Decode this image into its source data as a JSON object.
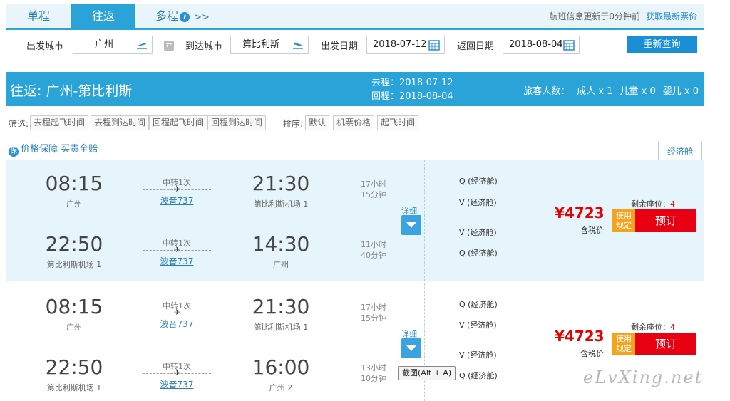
{
  "tabs": [
    {
      "label": "单程"
    },
    {
      "label": "往返"
    },
    {
      "label": "多程"
    }
  ],
  "tab_more": ">>",
  "update_text": "航班信息更新于0分钟前",
  "update_link": "获取最新票价",
  "search": {
    "from_label": "出发城市",
    "from_value": "广州",
    "to_label": "到达城市",
    "to_value": "第比利斯",
    "depart_label": "出发日期",
    "depart_value": "2018-07-12",
    "return_label": "返回日期",
    "return_value": "2018-08-04",
    "requery": "重新查询"
  },
  "route": {
    "title": "往返: 广州-第比利斯",
    "outbound": "去程：2018-07-12",
    "inbound": "回程：2018-08-04",
    "pax_label": "旅客人数：",
    "adult": "成人 x 1",
    "child": "儿童 x 0",
    "infant": "婴儿 x 0"
  },
  "filters": {
    "label": "筛选:",
    "items": [
      "去程起飞时间",
      "去程到达时间",
      "回程起飞时间",
      "回程到达时间"
    ],
    "sort_label": "排序:",
    "sort_items": [
      "默认",
      "机票价格",
      "起飞时间"
    ]
  },
  "guarantee": {
    "icon": "保",
    "text": "价格保障 买贵全赔"
  },
  "cabin_tab": "经济舱",
  "flights": [
    {
      "out": {
        "dep_time": "08:15",
        "dep_place": "广州",
        "transfer": "中转1次",
        "aircraft": "波音737",
        "arr_time": "21:30",
        "arr_place": "第比利斯机场 1",
        "dur1": "17小时",
        "dur2": "15分钟"
      },
      "ret": {
        "dep_time": "22:50",
        "dep_place": "第比利斯机场 1",
        "transfer": "中转1次",
        "aircraft": "波音737",
        "arr_time": "14:30",
        "arr_place": "广州",
        "dur1": "11小时",
        "dur2": "40分钟"
      },
      "classes": [
        "Q (经济舱)",
        "V (经济舱)",
        "V (经济舱)",
        "Q (经济舱)"
      ],
      "detail": "详细",
      "seats_label": "剩余座位：",
      "seats": "4",
      "price": "¥4723",
      "tax": "含税价",
      "rules": "使用规定",
      "book": "预订"
    },
    {
      "out": {
        "dep_time": "08:15",
        "dep_place": "广州",
        "transfer": "中转1次",
        "aircraft": "波音737",
        "arr_time": "21:30",
        "arr_place": "第比利斯机场 1",
        "dur1": "17小时",
        "dur2": "15分钟"
      },
      "ret": {
        "dep_time": "22:50",
        "dep_place": "第比利斯机场 1",
        "transfer": "中转1次",
        "aircraft": "波音737",
        "arr_time": "16:00",
        "arr_place": "广州 2",
        "dur1": "13小时",
        "dur2": "10分钟"
      },
      "classes": [
        "Q (经济舱)",
        "V (经济舱)",
        "V (经济舱)",
        "Q (经济舱)"
      ],
      "detail": "详细",
      "seats_label": "剩余座位：",
      "seats": "4",
      "price": "¥4723",
      "tax": "含税价",
      "rules": "使用规定",
      "book": "预订"
    }
  ],
  "tooltip": "截图(Alt + A)",
  "watermark": "eLvXing.net",
  "colors": {
    "accent": "#2aa3d8",
    "book": "#e60012",
    "rules": "#f7a21b",
    "price": "#e60000"
  }
}
